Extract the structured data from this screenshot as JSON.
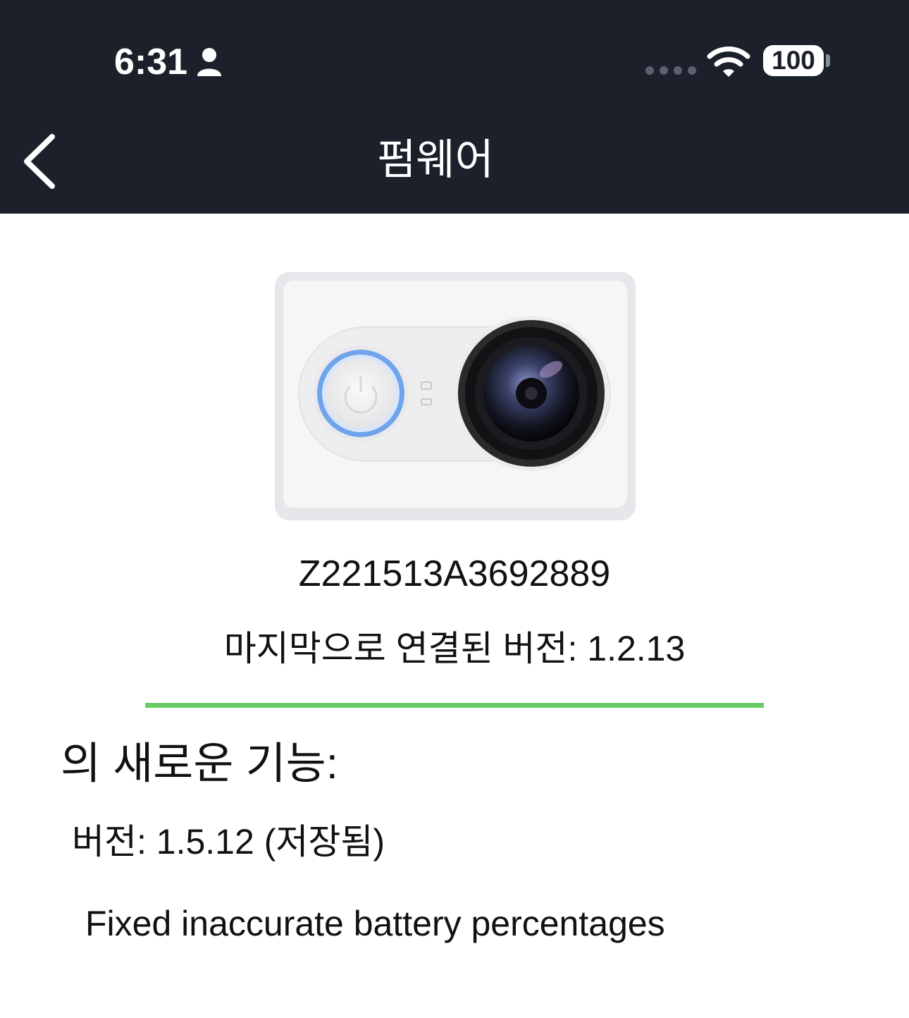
{
  "status_bar": {
    "time": "6:31",
    "battery": "100"
  },
  "nav": {
    "title": "펌웨어"
  },
  "device": {
    "serial": "Z221513A3692889",
    "last_connected_version": "마지막으로 연결된 버전: 1.2.13"
  },
  "colors": {
    "header_bg": "#1b202a",
    "divider": "#66cc66"
  },
  "features": {
    "heading": "의 새로운 기능:",
    "version": "버전: 1.5.12 (저장됨)",
    "notes": [
      "Fixed inaccurate battery percentages"
    ]
  }
}
